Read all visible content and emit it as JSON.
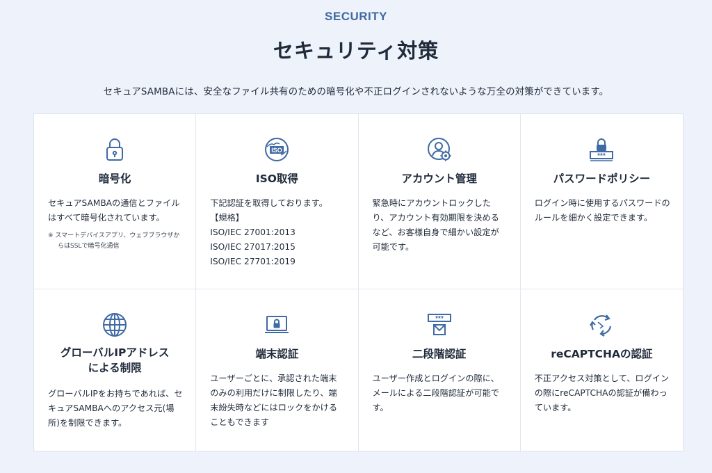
{
  "section": {
    "eyebrow": "SECURITY",
    "title": "セキュリティ対策",
    "lead": "セキュアSAMBAには、安全なファイル共有のための暗号化や不正ログインされないような万全の対策ができています。"
  },
  "colors": {
    "accent": "#3f6aa3",
    "background": "#eef2fa",
    "card": "#ffffff",
    "text": "#1f2a3a"
  },
  "features": [
    {
      "icon": "padlock-icon",
      "title": "暗号化",
      "body": "セキュアSAMBAの通信とファイルはすべて暗号化されています。",
      "note": "※ スマートデバイスアプリ、ウェブブラウザからはSSLで暗号化通信"
    },
    {
      "icon": "iso-globe-icon",
      "icon_text": "ISO",
      "title": "ISO取得",
      "body_lines": [
        "下記認証を取得しております。",
        "【規格】",
        "ISO/IEC 27001:2013",
        "ISO/IEC 27017:2015",
        "ISO/IEC 27701:2019"
      ]
    },
    {
      "icon": "user-gear-icon",
      "title": "アカウント管理",
      "body": "緊急時にアカウントロックしたり、アカウント有効期限を決めるなど、お客様自身で細かい設定が可能です。"
    },
    {
      "icon": "password-lock-icon",
      "icon_text": "***",
      "title": "パスワードポリシー",
      "body": "ログイン時に使用するパスワードのルールを細かく設定できます。"
    },
    {
      "icon": "globe-icon",
      "title_lines": [
        "グローバルIPアドレス",
        "による制限"
      ],
      "body": "グローバルIPをお持ちであれば、セキュアSAMBAへのアクセス元(場所)を制限できます。"
    },
    {
      "icon": "laptop-lock-icon",
      "title": "端末認証",
      "body": "ユーザーごとに、承認された端末のみの利用だけに制限したり、端末紛失時などにはロックをかけることもできます"
    },
    {
      "icon": "password-mail-icon",
      "icon_text": "***",
      "title": "二段階認証",
      "body": "ユーザー作成とログインの際に、メールによる二段階認証が可能です。"
    },
    {
      "icon": "recaptcha-icon",
      "title": "reCAPTCHAの認証",
      "body": "不正アクセス対策として、ログインの際にreCAPTCHAの認証が備わっています。"
    }
  ]
}
